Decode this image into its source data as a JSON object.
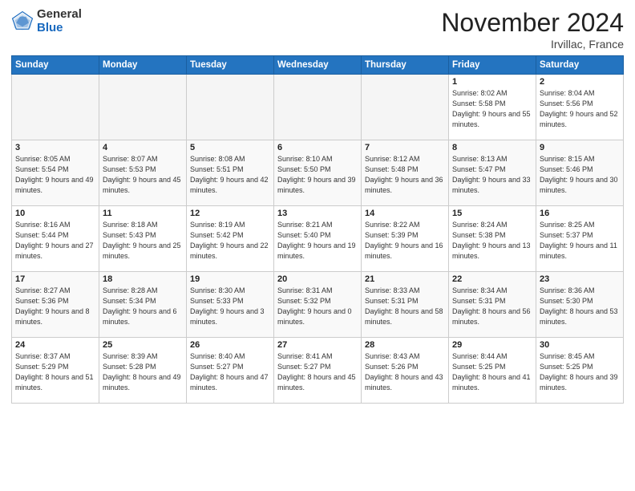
{
  "header": {
    "logo_general": "General",
    "logo_blue": "Blue",
    "month_title": "November 2024",
    "location": "Irvillac, France"
  },
  "days_of_week": [
    "Sunday",
    "Monday",
    "Tuesday",
    "Wednesday",
    "Thursday",
    "Friday",
    "Saturday"
  ],
  "weeks": [
    [
      {
        "day": "",
        "info": ""
      },
      {
        "day": "",
        "info": ""
      },
      {
        "day": "",
        "info": ""
      },
      {
        "day": "",
        "info": ""
      },
      {
        "day": "",
        "info": ""
      },
      {
        "day": "1",
        "info": "Sunrise: 8:02 AM\nSunset: 5:58 PM\nDaylight: 9 hours and 55 minutes."
      },
      {
        "day": "2",
        "info": "Sunrise: 8:04 AM\nSunset: 5:56 PM\nDaylight: 9 hours and 52 minutes."
      }
    ],
    [
      {
        "day": "3",
        "info": "Sunrise: 8:05 AM\nSunset: 5:54 PM\nDaylight: 9 hours and 49 minutes."
      },
      {
        "day": "4",
        "info": "Sunrise: 8:07 AM\nSunset: 5:53 PM\nDaylight: 9 hours and 45 minutes."
      },
      {
        "day": "5",
        "info": "Sunrise: 8:08 AM\nSunset: 5:51 PM\nDaylight: 9 hours and 42 minutes."
      },
      {
        "day": "6",
        "info": "Sunrise: 8:10 AM\nSunset: 5:50 PM\nDaylight: 9 hours and 39 minutes."
      },
      {
        "day": "7",
        "info": "Sunrise: 8:12 AM\nSunset: 5:48 PM\nDaylight: 9 hours and 36 minutes."
      },
      {
        "day": "8",
        "info": "Sunrise: 8:13 AM\nSunset: 5:47 PM\nDaylight: 9 hours and 33 minutes."
      },
      {
        "day": "9",
        "info": "Sunrise: 8:15 AM\nSunset: 5:46 PM\nDaylight: 9 hours and 30 minutes."
      }
    ],
    [
      {
        "day": "10",
        "info": "Sunrise: 8:16 AM\nSunset: 5:44 PM\nDaylight: 9 hours and 27 minutes."
      },
      {
        "day": "11",
        "info": "Sunrise: 8:18 AM\nSunset: 5:43 PM\nDaylight: 9 hours and 25 minutes."
      },
      {
        "day": "12",
        "info": "Sunrise: 8:19 AM\nSunset: 5:42 PM\nDaylight: 9 hours and 22 minutes."
      },
      {
        "day": "13",
        "info": "Sunrise: 8:21 AM\nSunset: 5:40 PM\nDaylight: 9 hours and 19 minutes."
      },
      {
        "day": "14",
        "info": "Sunrise: 8:22 AM\nSunset: 5:39 PM\nDaylight: 9 hours and 16 minutes."
      },
      {
        "day": "15",
        "info": "Sunrise: 8:24 AM\nSunset: 5:38 PM\nDaylight: 9 hours and 13 minutes."
      },
      {
        "day": "16",
        "info": "Sunrise: 8:25 AM\nSunset: 5:37 PM\nDaylight: 9 hours and 11 minutes."
      }
    ],
    [
      {
        "day": "17",
        "info": "Sunrise: 8:27 AM\nSunset: 5:36 PM\nDaylight: 9 hours and 8 minutes."
      },
      {
        "day": "18",
        "info": "Sunrise: 8:28 AM\nSunset: 5:34 PM\nDaylight: 9 hours and 6 minutes."
      },
      {
        "day": "19",
        "info": "Sunrise: 8:30 AM\nSunset: 5:33 PM\nDaylight: 9 hours and 3 minutes."
      },
      {
        "day": "20",
        "info": "Sunrise: 8:31 AM\nSunset: 5:32 PM\nDaylight: 9 hours and 0 minutes."
      },
      {
        "day": "21",
        "info": "Sunrise: 8:33 AM\nSunset: 5:31 PM\nDaylight: 8 hours and 58 minutes."
      },
      {
        "day": "22",
        "info": "Sunrise: 8:34 AM\nSunset: 5:31 PM\nDaylight: 8 hours and 56 minutes."
      },
      {
        "day": "23",
        "info": "Sunrise: 8:36 AM\nSunset: 5:30 PM\nDaylight: 8 hours and 53 minutes."
      }
    ],
    [
      {
        "day": "24",
        "info": "Sunrise: 8:37 AM\nSunset: 5:29 PM\nDaylight: 8 hours and 51 minutes."
      },
      {
        "day": "25",
        "info": "Sunrise: 8:39 AM\nSunset: 5:28 PM\nDaylight: 8 hours and 49 minutes."
      },
      {
        "day": "26",
        "info": "Sunrise: 8:40 AM\nSunset: 5:27 PM\nDaylight: 8 hours and 47 minutes."
      },
      {
        "day": "27",
        "info": "Sunrise: 8:41 AM\nSunset: 5:27 PM\nDaylight: 8 hours and 45 minutes."
      },
      {
        "day": "28",
        "info": "Sunrise: 8:43 AM\nSunset: 5:26 PM\nDaylight: 8 hours and 43 minutes."
      },
      {
        "day": "29",
        "info": "Sunrise: 8:44 AM\nSunset: 5:25 PM\nDaylight: 8 hours and 41 minutes."
      },
      {
        "day": "30",
        "info": "Sunrise: 8:45 AM\nSunset: 5:25 PM\nDaylight: 8 hours and 39 minutes."
      }
    ]
  ]
}
